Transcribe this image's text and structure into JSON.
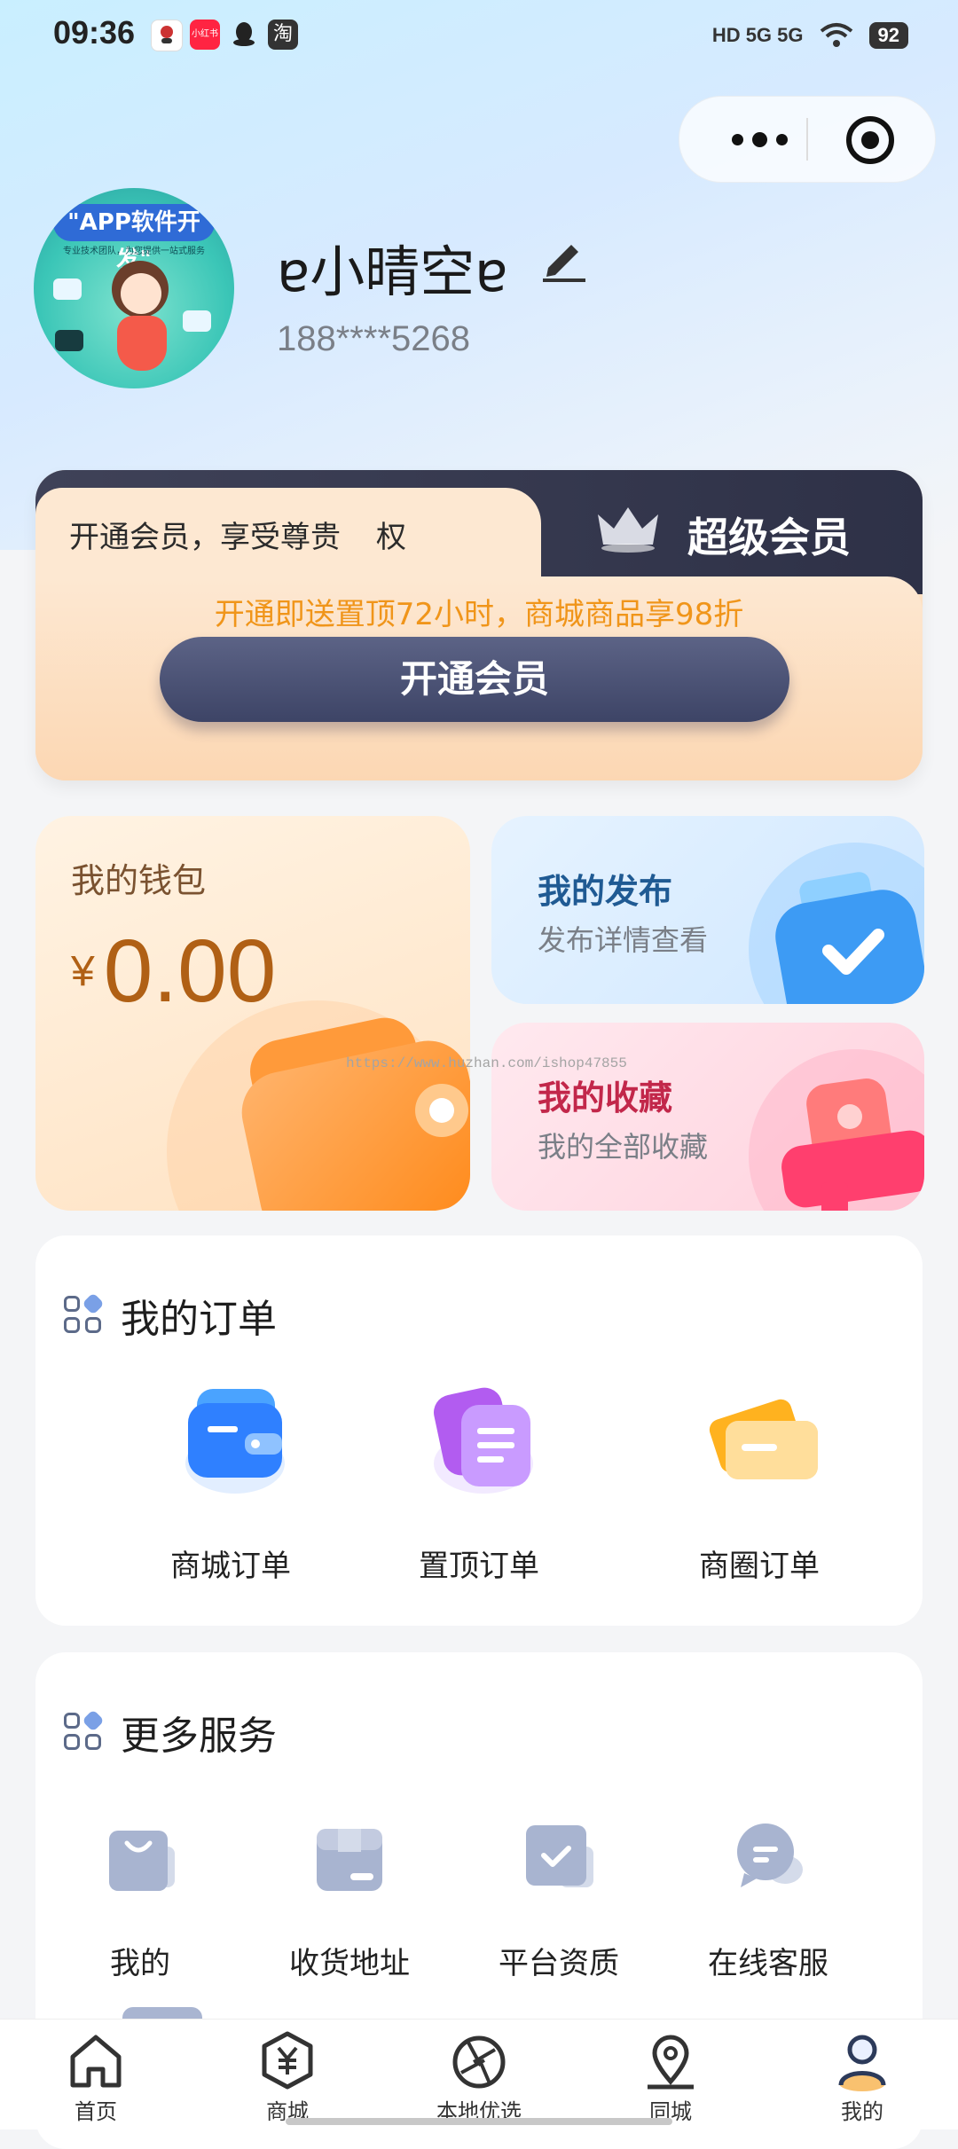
{
  "status_bar": {
    "time": "09:36",
    "app_icons": [
      "camera-app-icon",
      "xiaohongshu-icon",
      "qq-icon",
      "taobao-icon"
    ],
    "xiaohongshu_label": "小红书",
    "taobao_label": "淘",
    "network": "HD 5G 5G",
    "battery": "92"
  },
  "profile": {
    "avatar_banner": "\"APP软件开发\"",
    "avatar_sub": "专业技术团队，为您提供一站式服务",
    "nickname": "ɐ小晴空ɐ",
    "phone": "188****5268"
  },
  "vip": {
    "slogan": "开通会员，享受尊贵",
    "slogan_tail": "权",
    "title": "超级会员",
    "promo": "开通即送置顶72小时，商城商品享98折",
    "button": "开通会员"
  },
  "wallet": {
    "title": "我的钱包",
    "currency": "¥",
    "amount": "0.00"
  },
  "publish": {
    "title": "我的发布",
    "subtitle": "发布详情查看"
  },
  "favorites": {
    "title": "我的收藏",
    "subtitle": "我的全部收藏"
  },
  "watermark": "https://www.huzhan.com/ishop47855",
  "orders": {
    "title": "我的订单",
    "items": [
      {
        "label": "商城订单",
        "icon": "wallet-order-icon"
      },
      {
        "label": "置顶订单",
        "icon": "document-order-icon"
      },
      {
        "label": "商圈订单",
        "icon": "card-order-icon"
      }
    ]
  },
  "services": {
    "title": "更多服务",
    "items": [
      {
        "label": "我的 ",
        "icon": "bag-icon"
      },
      {
        "label": "收货地址",
        "icon": "box-icon"
      },
      {
        "label": "平台资质",
        "icon": "certificate-icon"
      },
      {
        "label": "在线客服",
        "icon": "chat-icon"
      }
    ]
  },
  "tabbar": {
    "items": [
      {
        "label": "首页",
        "icon": "home-icon"
      },
      {
        "label": "商城",
        "icon": "shop-yen-icon"
      },
      {
        "label": "本地优选",
        "icon": "aperture-icon"
      },
      {
        "label": "同城",
        "icon": "location-pin-icon"
      },
      {
        "label": "我的",
        "icon": "user-icon",
        "active": true
      }
    ],
    "active_color": "#f8b14b"
  },
  "colors": {
    "vip_dark": "#2e3147",
    "vip_promo": "#f0951a",
    "wallet_amount": "#b06015",
    "publish_title": "#1f5a93",
    "favorite_title": "#c2274a"
  }
}
